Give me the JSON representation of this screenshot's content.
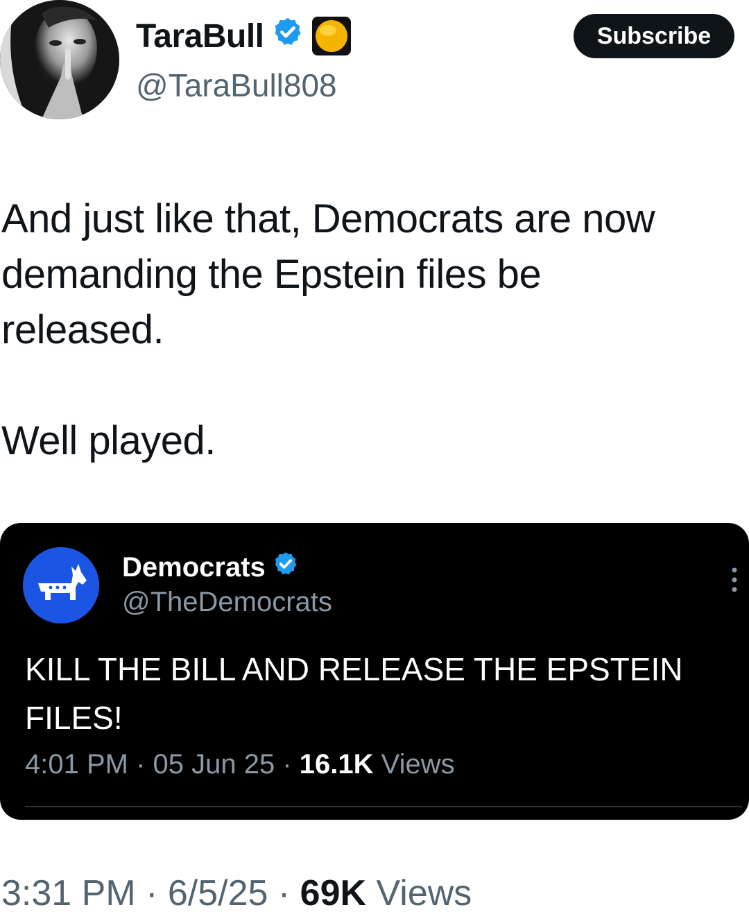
{
  "tweet": {
    "author": {
      "display_name": "TaraBull",
      "handle": "@TaraBull808"
    },
    "subscribe_label": "Subscribe",
    "text_lines": [
      "And just like that, Democrats are now",
      "demanding the Epstein files be",
      "released.",
      "Well played."
    ],
    "meta": {
      "time": "3:31 PM",
      "sep1": " · ",
      "date": "6/5/25",
      "sep2": " · ",
      "views_count": "69K",
      "views_label": " Views"
    }
  },
  "quote": {
    "author": {
      "display_name": "Democrats",
      "handle": "@TheDemocrats"
    },
    "text": "KILL THE BILL AND RELEASE THE EPSTEIN FILES!",
    "meta": {
      "time": "4:01 PM",
      "sep1": " · ",
      "date": "05 Jun 25",
      "sep2": " · ",
      "views_count": "16.1K",
      "views_label": " Views"
    }
  },
  "colors": {
    "verified_blue": "#1d9bf0",
    "democrats_blue": "#1a55e3",
    "badge_yellow": "#f5b400"
  },
  "icons": {
    "verified": "verified-badge-icon",
    "affiliate": "yellow-circle-badge-icon",
    "donkey": "democrats-donkey-icon",
    "more": "more-options-icon"
  }
}
